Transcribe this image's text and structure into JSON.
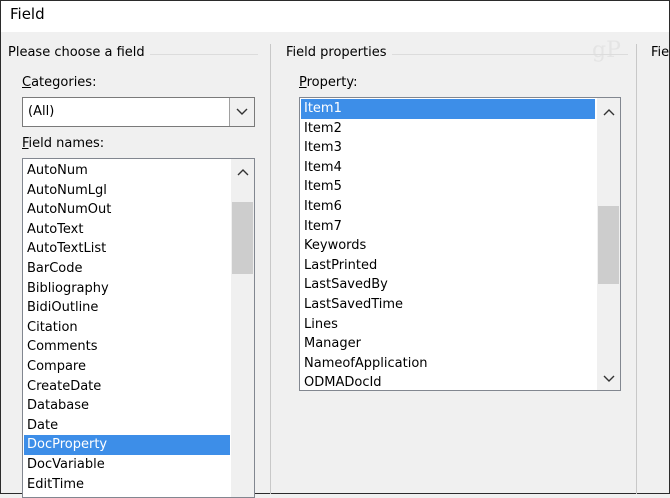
{
  "dialog": {
    "title": "Field"
  },
  "left_section": {
    "title": "Please choose a field",
    "categories_label": "Categories:",
    "categories_accel": "C",
    "categories_rest": "ategories:",
    "categories_value": "(All)",
    "field_names_label": "Field names:",
    "field_names_accel": "F",
    "field_names_rest": "ield names:",
    "field_names": [
      "AutoNum",
      "AutoNumLgl",
      "AutoNumOut",
      "AutoText",
      "AutoTextList",
      "BarCode",
      "Bibliography",
      "BidiOutline",
      "Citation",
      "Comments",
      "Compare",
      "CreateDate",
      "Database",
      "Date",
      "DocProperty",
      "DocVariable",
      "EditTime"
    ],
    "selected_field": "DocProperty"
  },
  "middle_section": {
    "title": "Field properties",
    "property_label": "Property:",
    "property_accel": "P",
    "property_rest": "roperty:",
    "properties": [
      "Item1",
      "Item2",
      "Item3",
      "Item4",
      "Item5",
      "Item6",
      "Item7",
      "Keywords",
      "LastPrinted",
      "LastSavedBy",
      "LastSavedTime",
      "Lines",
      "Manager",
      "NameofApplication",
      "ODMADocId"
    ],
    "selected_property": "Item1"
  },
  "right_section": {
    "title": "Fie"
  },
  "watermark": "gP",
  "icons": {
    "dropdown": "chevron-down-icon",
    "scroll_up": "chevron-up-icon",
    "scroll_down": "chevron-down-icon"
  }
}
